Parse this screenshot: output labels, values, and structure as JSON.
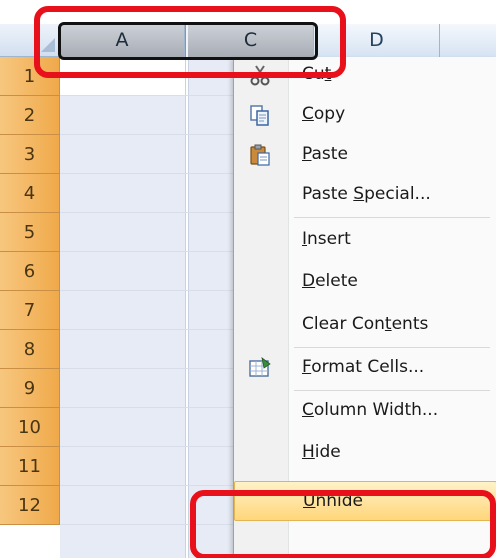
{
  "columns": [
    {
      "label": "A",
      "selected": true
    },
    {
      "label": "C",
      "selected": true
    },
    {
      "label": "D",
      "selected": false
    }
  ],
  "rows": [
    "1",
    "2",
    "3",
    "4",
    "5",
    "6",
    "7",
    "8",
    "9",
    "10",
    "11",
    "12"
  ],
  "context_menu": {
    "items": [
      {
        "label": "Cut",
        "icon": "scissors-icon"
      },
      {
        "label": "Copy",
        "icon": "copy-icon"
      },
      {
        "label": "Paste",
        "icon": "paste-icon"
      },
      {
        "label": "Paste Special...",
        "icon": ""
      },
      {
        "label": "Insert",
        "icon": ""
      },
      {
        "label": "Delete",
        "icon": ""
      },
      {
        "label": "Clear Contents",
        "icon": ""
      },
      {
        "label": "Format Cells...",
        "icon": "format-cells-icon"
      },
      {
        "label": "Column Width...",
        "icon": ""
      },
      {
        "label": "Hide",
        "icon": ""
      },
      {
        "label": "Unhide",
        "icon": "",
        "highlighted": true
      }
    ]
  },
  "colors": {
    "annotation": "#e8101a",
    "row_header": "#f0a94a",
    "selection": "#e6ebf5",
    "menu_highlight": "#ffd67a"
  }
}
